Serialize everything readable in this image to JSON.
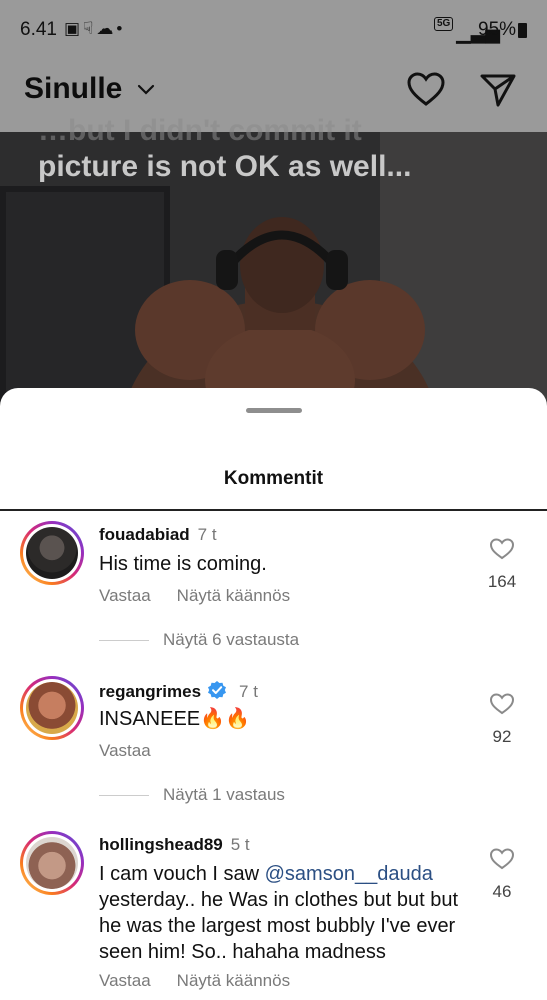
{
  "status_bar": {
    "time": "6.41",
    "icons": "▣☟☁•",
    "network": "5G",
    "signal": "▁▃▅",
    "battery": "95%"
  },
  "header": {
    "title": "Sinulle"
  },
  "post": {
    "caption_faint": "…but I didn't commit it",
    "caption": "picture is not OK as well..."
  },
  "sheet": {
    "title": "Kommentit"
  },
  "comments": [
    {
      "username": "fouadabiad",
      "ago": "7 t",
      "text": "His time is coming.",
      "likes": "164",
      "reply_label": "Vastaa",
      "translate_label": "Näytä käännös",
      "replies_label": "Näytä 6 vastausta"
    },
    {
      "username": "regangrimes",
      "ago": "7 t",
      "text": "INSANEEE🔥🔥",
      "likes": "92",
      "reply_label": "Vastaa",
      "replies_label": "Näytä 1 vastaus"
    },
    {
      "username": "hollingshead89",
      "ago": "5 t",
      "text_before": "I cam vouch I saw ",
      "mention": "@samson__dauda",
      "text_after": " yesterday.. he Was in clothes but but but he was the largest most bubbly I've ever seen him! So.. hahaha madness",
      "likes": "46",
      "reply_label": "Vastaa",
      "translate_label": "Näytä käännös"
    }
  ],
  "colors": {
    "verified": "#3897f0",
    "mention": "#2b4f83"
  }
}
